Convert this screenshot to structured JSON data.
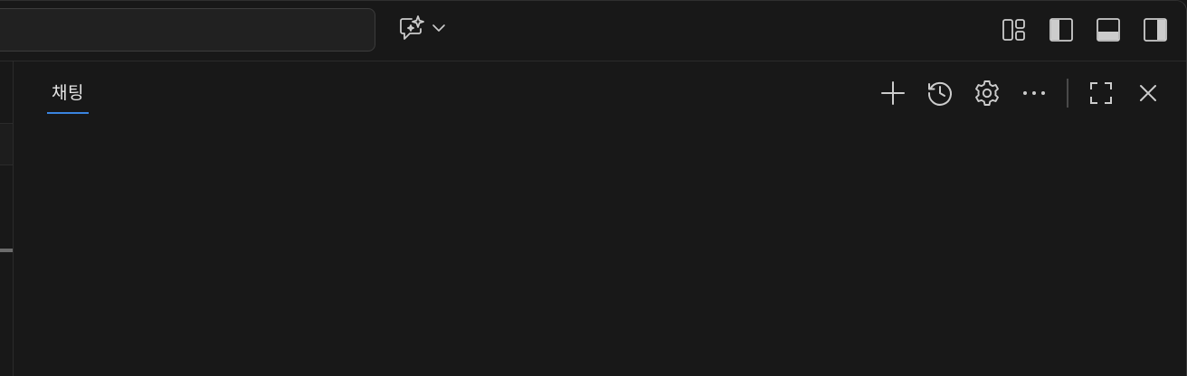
{
  "titlebar": {
    "command_center": {
      "placeholder": ""
    },
    "copilot_menu": {
      "icon": "copilot-chat-sparkle-icon",
      "dropdown_icon": "chevron-down-icon"
    },
    "layout_controls": [
      {
        "name": "customize-layout-button",
        "icon": "layout-grid-icon"
      },
      {
        "name": "toggle-primary-sidebar-button",
        "icon": "sidebar-left-icon"
      },
      {
        "name": "toggle-panel-button",
        "icon": "panel-bottom-icon"
      },
      {
        "name": "toggle-secondary-sidebar-button",
        "icon": "sidebar-right-icon"
      }
    ]
  },
  "chat_panel": {
    "tabs": [
      {
        "label": "채팅",
        "active": true
      }
    ],
    "actions": [
      {
        "name": "new-chat-button",
        "icon": "plus-icon"
      },
      {
        "name": "chat-history-button",
        "icon": "history-icon"
      },
      {
        "name": "chat-settings-button",
        "icon": "gear-icon"
      },
      {
        "name": "more-actions-button",
        "icon": "ellipsis-icon"
      },
      {
        "name": "maximize-panel-button",
        "icon": "fullscreen-icon"
      },
      {
        "name": "close-panel-button",
        "icon": "close-icon"
      }
    ]
  },
  "colors": {
    "background": "#181818",
    "border": "#2b2b2b",
    "accent": "#3a84e0",
    "icon": "#cccccc",
    "text": "#e6e6e6"
  }
}
